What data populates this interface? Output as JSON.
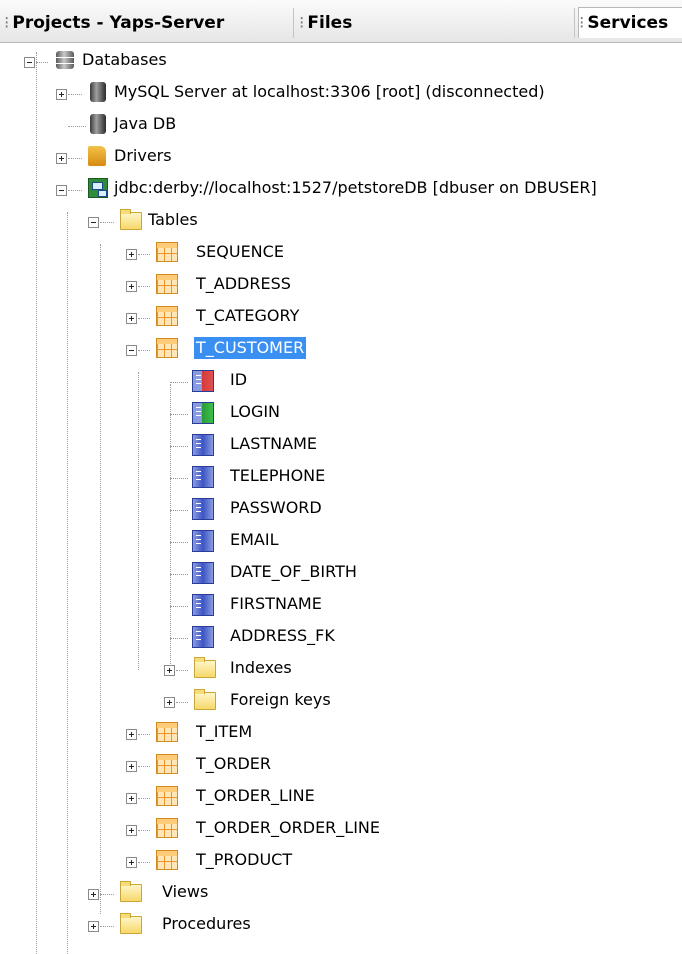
{
  "tabs": [
    {
      "label": "Projects - Yaps-Server",
      "active": false
    },
    {
      "label": "Files",
      "active": false
    },
    {
      "label": "Services",
      "active": true
    }
  ],
  "tree": {
    "databases": "Databases",
    "mysql": "MySQL Server at localhost:3306 [root] (disconnected)",
    "javadb": "Java DB",
    "drivers": "Drivers",
    "connection": "jdbc:derby://localhost:1527/petstoreDB [dbuser on DBUSER]",
    "tables": "Tables",
    "table_list_before": [
      "SEQUENCE",
      "T_ADDRESS",
      "T_CATEGORY"
    ],
    "selected_table": "T_CUSTOMER",
    "columns": [
      "ID",
      "LOGIN",
      "LASTNAME",
      "TELEPHONE",
      "PASSWORD",
      "EMAIL",
      "DATE_OF_BIRTH",
      "FIRSTNAME",
      "ADDRESS_FK"
    ],
    "indexes": "Indexes",
    "foreign_keys": "Foreign keys",
    "table_list_after": [
      "T_ITEM",
      "T_ORDER",
      "T_ORDER_LINE",
      "T_ORDER_ORDER_LINE",
      "T_PRODUCT"
    ],
    "views": "Views",
    "procedures": "Procedures"
  },
  "colors": {
    "selection": "#3a8ff2",
    "table_icon": "#ffcc7a",
    "column_icon": "#3c55c4",
    "primary_key_marker": "#d63a3a",
    "index_marker": "#2a9a3a"
  }
}
